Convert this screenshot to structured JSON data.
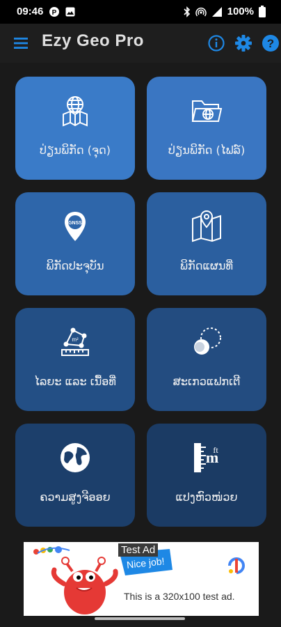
{
  "status_bar": {
    "time": "09:46",
    "battery": "100%"
  },
  "app_bar": {
    "title": "Ezy Geo Pro",
    "icons": [
      "menu-icon",
      "info-icon",
      "settings-icon",
      "help-icon"
    ],
    "accent_color": "#1e88e5"
  },
  "tiles": [
    {
      "label": "ປ່ຽນພິກັດ (ຈຸດ)",
      "icon": "globe-map-icon",
      "color": "#3a7bc8"
    },
    {
      "label": "ປ່ຽນພິກັດ (ໄຟລ໌)",
      "icon": "folder-globe-icon",
      "color": "#3a76c2"
    },
    {
      "label": "ພິກັດປະຈຸບັນ",
      "icon": "gnss-pin-icon",
      "color": "#2e66aa"
    },
    {
      "label": "ພິກັດແຜນທີ່",
      "icon": "map-pin-icon",
      "color": "#2b5f9f"
    },
    {
      "label": "ໄລຍະ ແລະ ເນື້ອທີ່",
      "icon": "measure-area-icon",
      "color": "#234f85"
    },
    {
      "label": "ສະເກວແຟກເຕີ",
      "icon": "scale-factor-icon",
      "color": "#234c80"
    },
    {
      "label": "ຄວາມສູງຈີອອຍ",
      "icon": "earth-icon",
      "color": "#1c3f6b"
    },
    {
      "label": "ແປງຫົວໜ່ວຍ",
      "icon": "unit-ruler-icon",
      "color": "#1b3b64"
    }
  ],
  "ad": {
    "tag": "Test Ad",
    "text": "This is a 320x100 test ad.",
    "bubble": "Nice job!"
  }
}
